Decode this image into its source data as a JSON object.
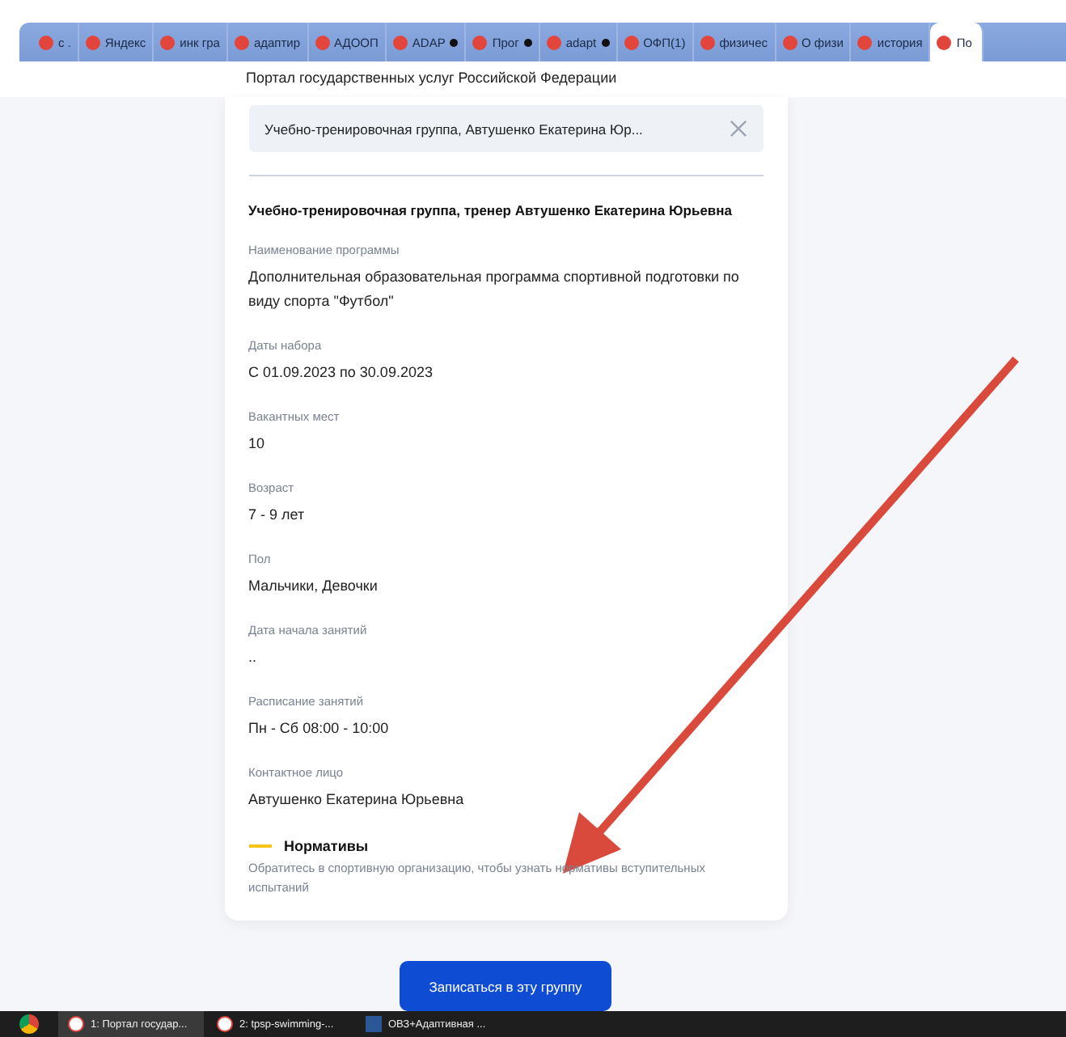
{
  "browser_tabs": [
    {
      "title": "с .",
      "dot": false,
      "selected": false
    },
    {
      "title": "Яндекс",
      "dot": false,
      "selected": false
    },
    {
      "title": "инк гра",
      "dot": false,
      "selected": false
    },
    {
      "title": "адаптир",
      "dot": false,
      "selected": false
    },
    {
      "title": "АДООП",
      "dot": false,
      "selected": false
    },
    {
      "title": "ADAP",
      "dot": true,
      "selected": false
    },
    {
      "title": "Прог",
      "dot": true,
      "selected": false
    },
    {
      "title": "adapt",
      "dot": true,
      "selected": false
    },
    {
      "title": "ОФП(1)",
      "dot": false,
      "selected": false
    },
    {
      "title": "физичес",
      "dot": false,
      "selected": false
    },
    {
      "title": "О физи",
      "dot": false,
      "selected": false
    },
    {
      "title": "история",
      "dot": false,
      "selected": false
    },
    {
      "title": "По",
      "dot": false,
      "selected": true
    }
  ],
  "page_title": "Портал государственных услуг Российской Федерации",
  "selected_group": {
    "value": "Учебно-тренировочная группа, Автушенко Екатерина Юр..."
  },
  "group_title": "Учебно-тренировочная группа, тренер Автушенко Екатерина Юрьевна",
  "fields": [
    {
      "label": "Наименование программы",
      "value": "Дополнительная образовательная программа спортивной подготовки по виду спорта \"Футбол\""
    },
    {
      "label": "Даты набора",
      "value": "С 01.09.2023 по 30.09.2023"
    },
    {
      "label": "Вакантных мест",
      "value": "10"
    },
    {
      "label": "Возраст",
      "value": "7 - 9 лет"
    },
    {
      "label": "Пол",
      "value": "Мальчики, Девочки"
    },
    {
      "label": "Дата начала занятий",
      "value": ".."
    },
    {
      "label": "Расписание занятий",
      "value": "Пн - Сб 08:00 - 10:00"
    },
    {
      "label": "Контактное лицо",
      "value": "Автушенко Екатерина Юрьевна"
    }
  ],
  "standards": {
    "title": "Нормативы",
    "note": "Обратитесь в спортивную организацию, чтобы узнать нормативы вступительных испытаний"
  },
  "enroll_button": "Записаться в эту группу",
  "taskbar": [
    {
      "kind": "browser",
      "title": "1: Портал государ...",
      "selected": true
    },
    {
      "kind": "browser",
      "title": "2: tpsp-swimming-...",
      "selected": false
    },
    {
      "kind": "word",
      "title": "ОВЗ+Адаптивная ...",
      "selected": false
    }
  ]
}
